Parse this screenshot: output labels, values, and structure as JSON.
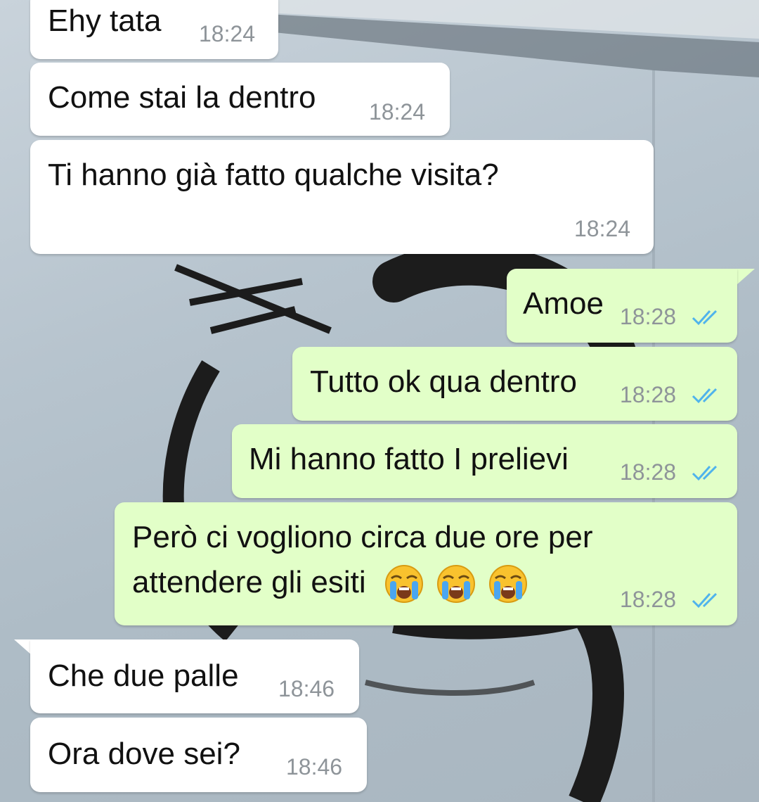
{
  "colors": {
    "incoming_bubble": "#ffffff",
    "outgoing_bubble": "#e2ffc8",
    "timestamp": "#8e9499",
    "read_ticks": "#4fb3ec"
  },
  "messages": [
    {
      "direction": "incoming",
      "text": "Ehy tata",
      "time": "18:24"
    },
    {
      "direction": "incoming",
      "text": "Come stai la dentro",
      "time": "18:24"
    },
    {
      "direction": "incoming",
      "text": "Ti hanno già fatto qualche visita?",
      "time": "18:24"
    },
    {
      "direction": "outgoing",
      "text": "Amoe",
      "time": "18:28",
      "status": "read-double-check-icon"
    },
    {
      "direction": "outgoing",
      "text": "Tutto ok qua dentro",
      "time": "18:28",
      "status": "read-double-check-icon"
    },
    {
      "direction": "outgoing",
      "text": "Mi hanno fatto I prelievi",
      "time": "18:28",
      "status": "read-double-check-icon"
    },
    {
      "direction": "outgoing",
      "line1": "Però ci vogliono circa due ore per",
      "line2": "attendere gli esiti",
      "emojis": [
        "loudly-crying-face-icon",
        "loudly-crying-face-icon",
        "loudly-crying-face-icon"
      ],
      "time": "18:28",
      "status": "read-double-check-icon"
    },
    {
      "direction": "incoming",
      "text": "Che due palle",
      "time": "18:46"
    },
    {
      "direction": "incoming",
      "text": "Ora dove sei?",
      "time": "18:46"
    }
  ]
}
